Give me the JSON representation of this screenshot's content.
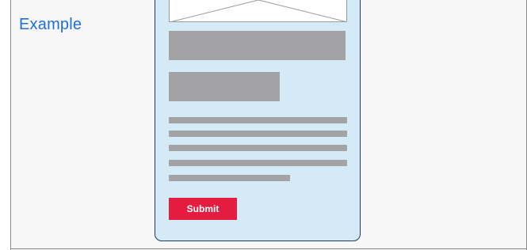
{
  "label": "Example",
  "form": {
    "submit_label": "Submit",
    "text_line_count": 5
  },
  "colors": {
    "label": "#1f6fd4",
    "card_background": "#d4eaf7",
    "card_border": "#1d3a6e",
    "placeholder_gray": "#a3a3a6",
    "submit_button": "#e41c3f",
    "page_background": "#f7f7f7"
  }
}
